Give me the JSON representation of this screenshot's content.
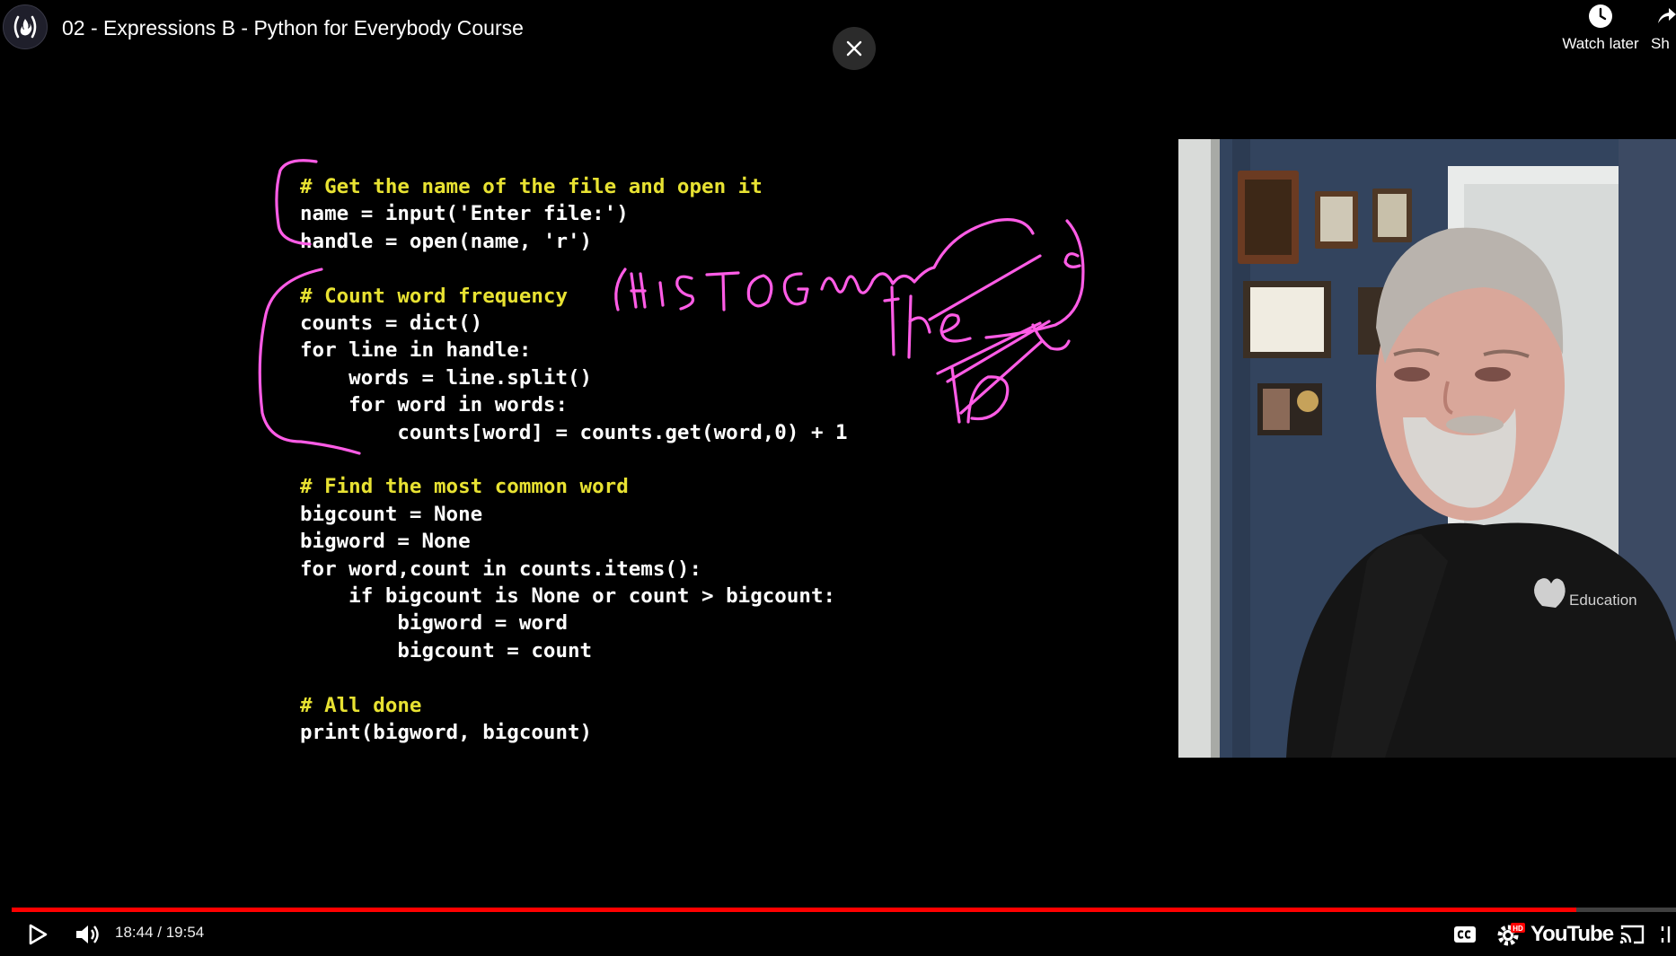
{
  "header": {
    "title": "02 - Expressions B - Python for Everybody Course",
    "watch_later_label": "Watch later",
    "share_label": "Sh"
  },
  "code": {
    "lines": [
      {
        "type": "comment",
        "text": "# Get the name of the file and open it"
      },
      {
        "type": "code",
        "text": "name = input('Enter file:')"
      },
      {
        "type": "code",
        "text": "handle = open(name, 'r')"
      },
      {
        "type": "blank",
        "text": ""
      },
      {
        "type": "comment",
        "text": "# Count word frequency"
      },
      {
        "type": "code",
        "text": "counts = dict()"
      },
      {
        "type": "code",
        "text": "for line in handle:"
      },
      {
        "type": "code",
        "text": "    words = line.split()"
      },
      {
        "type": "code",
        "text": "    for word in words:"
      },
      {
        "type": "code",
        "text": "        counts[word] = counts.get(word,0) + 1"
      },
      {
        "type": "blank",
        "text": ""
      },
      {
        "type": "comment",
        "text": "# Find the most common word"
      },
      {
        "type": "code",
        "text": "bigcount = None"
      },
      {
        "type": "code",
        "text": "bigword = None"
      },
      {
        "type": "code",
        "text": "for word,count in counts.items():"
      },
      {
        "type": "code",
        "text": "    if bigcount is None or count > bigcount:"
      },
      {
        "type": "code",
        "text": "        bigword = word"
      },
      {
        "type": "code",
        "text": "        bigcount = count"
      },
      {
        "type": "blank",
        "text": ""
      },
      {
        "type": "comment",
        "text": "# All done"
      },
      {
        "type": "code",
        "text": "print(bigword, bigcount)"
      }
    ]
  },
  "webcam": {
    "shirt_logo_text": "Education"
  },
  "player": {
    "time_display": "18:44 / 19:54",
    "progress_fraction": 0.94,
    "brand": "YouTube",
    "accent_color": "#ff0000",
    "comment_color": "#e8e232",
    "ink_color": "#ff5ce6"
  }
}
